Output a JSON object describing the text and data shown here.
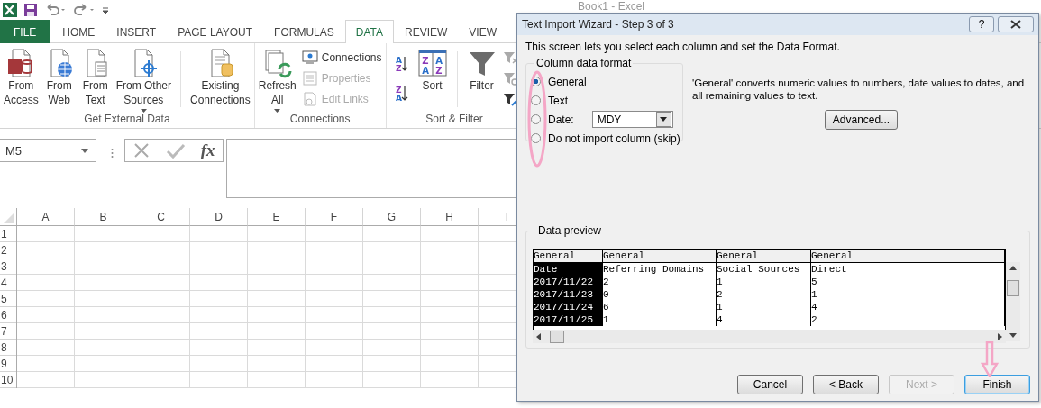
{
  "window_title": "Book1 - Excel",
  "ribbon_tabs": [
    {
      "label": "FILE",
      "kind": "file",
      "selected": false
    },
    {
      "label": "HOME",
      "kind": "tab",
      "selected": false
    },
    {
      "label": "INSERT",
      "kind": "tab",
      "selected": false
    },
    {
      "label": "PAGE LAYOUT",
      "kind": "tab",
      "selected": false
    },
    {
      "label": "FORMULAS",
      "kind": "tab",
      "selected": false
    },
    {
      "label": "DATA",
      "kind": "tab",
      "selected": true
    },
    {
      "label": "REVIEW",
      "kind": "tab",
      "selected": false
    },
    {
      "label": "VIEW",
      "kind": "tab",
      "selected": false
    }
  ],
  "ribbon_groups": [
    {
      "label": "Get External Data",
      "sections": [
        [
          {
            "kind": "large",
            "label": "From\nAccess",
            "dropdown": false
          },
          {
            "kind": "large",
            "label": "From\nWeb",
            "dropdown": false
          },
          {
            "kind": "large",
            "label": "From\nText",
            "dropdown": false
          },
          {
            "kind": "large",
            "label": "From Other\nSources",
            "dropdown": true
          }
        ],
        [
          {
            "kind": "large",
            "label": "Existing\nConnections",
            "dropdown": false
          }
        ]
      ]
    },
    {
      "label": "Connections",
      "sections": [
        [
          {
            "kind": "large",
            "label": "Refresh\nAll",
            "dropdown": true
          },
          {
            "kind": "stack",
            "items": [
              {
                "label": "Connections",
                "disabled": false
              },
              {
                "label": "Properties",
                "disabled": true
              },
              {
                "label": "Edit Links",
                "disabled": true
              }
            ]
          }
        ]
      ]
    },
    {
      "label": "Sort & Filter",
      "sections": [
        [
          {
            "kind": "sorts",
            "items": [
              {
                "letters": [
                  "A",
                  "Z"
                ]
              },
              {
                "letters": [
                  "Z",
                  "A"
                ]
              }
            ]
          },
          {
            "kind": "large",
            "letters": [
              "Z",
              "A",
              "A",
              "Z"
            ],
            "label": "Sort",
            "dropdown": false
          }
        ],
        [
          {
            "kind": "large",
            "label": "Filter",
            "dropdown": false
          },
          {
            "kind": "stack",
            "items": [
              {
                "disabled": true
              },
              {
                "disabled": true
              },
              {
                "disabled": false
              }
            ]
          }
        ]
      ]
    }
  ],
  "name_box": "M5",
  "function_label": "fx",
  "columns": [
    "A",
    "B",
    "C",
    "D",
    "E",
    "F",
    "G",
    "H",
    "I"
  ],
  "rows": [
    "1",
    "2",
    "3",
    "4",
    "5",
    "6",
    "7",
    "8",
    "9",
    "10"
  ],
  "dialog": {
    "title": "Text Import Wizard - Step 3 of 3",
    "help": "?",
    "intro": "This screen lets you select each column and set the Data Format.",
    "format_group": {
      "label": "Column data format",
      "options": [
        {
          "label": "General",
          "kind": "plain",
          "selected": true
        },
        {
          "label": "Text",
          "kind": "plain",
          "selected": false
        },
        {
          "label": "Date:",
          "kind": "date",
          "selected": false,
          "value": "MDY"
        },
        {
          "label": "Do not import column (skip)",
          "kind": "plain",
          "selected": false
        }
      ]
    },
    "description": "'General' converts numeric values to numbers, date values to dates, and all remaining values to text.",
    "advanced_button": "Advanced...",
    "preview": {
      "label": "Data preview",
      "columns": [
        {
          "header": "General",
          "selected": true
        },
        {
          "header": "General",
          "selected": false
        },
        {
          "header": "General",
          "selected": false
        },
        {
          "header": "General",
          "selected": false
        }
      ],
      "rows": [
        [
          "Date",
          "Referring Domains",
          "Social Sources",
          "Direct"
        ],
        [
          "2017/11/22",
          "2",
          "1",
          "5"
        ],
        [
          "2017/11/23",
          "0",
          "2",
          "1"
        ],
        [
          "2017/11/24",
          "6",
          "1",
          "4"
        ],
        [
          "2017/11/25",
          "1",
          "4",
          "2"
        ]
      ]
    },
    "buttons": [
      {
        "label": "Cancel",
        "disabled": false,
        "default": false
      },
      {
        "label": "< Back",
        "disabled": false,
        "default": false
      },
      {
        "label": "Next >",
        "disabled": true,
        "default": false
      },
      {
        "label": "Finish",
        "disabled": false,
        "default": true
      }
    ]
  }
}
